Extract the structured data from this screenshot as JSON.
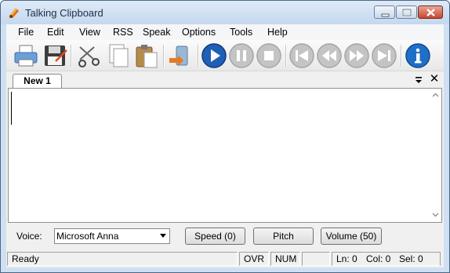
{
  "window": {
    "title": "Talking Clipboard"
  },
  "menu": [
    "File",
    "Edit",
    "View",
    "RSS",
    "Speak",
    "Options",
    "Tools",
    "Help"
  ],
  "toolbar": {
    "icons": [
      "print-icon",
      "save-icon",
      "cut-icon",
      "copy-icon",
      "paste-icon",
      "speak-clipboard-icon",
      "play-icon",
      "pause-icon",
      "stop-icon",
      "skip-start-icon",
      "rewind-icon",
      "fast-forward-icon",
      "skip-end-icon",
      "info-icon"
    ],
    "colors": {
      "play_blue": "#1f5fb8",
      "disabled_gray": "#b5b5b5",
      "info_blue": "#1f6fc9"
    }
  },
  "tabs": {
    "active_label": "New 1",
    "close_glyph": "✕"
  },
  "editor": {
    "text": ""
  },
  "controls": {
    "voice_label": "Voice:",
    "voice_value": "Microsoft Anna",
    "speed_label": "Speed (0)",
    "pitch_label": "Pitch",
    "volume_label": "Volume (50)"
  },
  "status": {
    "state": "Ready",
    "ovr": "OVR",
    "num": "NUM",
    "ln": "Ln: 0",
    "col": "Col: 0",
    "sel": "Sel: 0"
  }
}
